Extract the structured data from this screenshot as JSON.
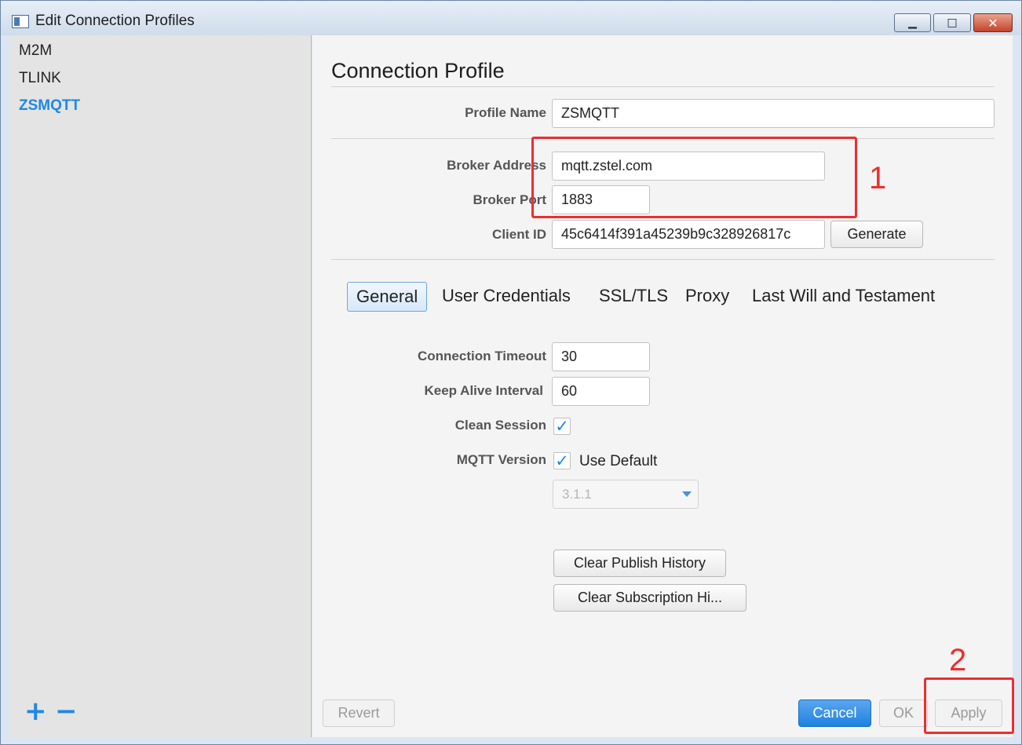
{
  "window": {
    "title": "Edit Connection Profiles"
  },
  "sidebar": {
    "profiles": [
      {
        "label": "M2M",
        "selected": false
      },
      {
        "label": "TLINK",
        "selected": false
      },
      {
        "label": "ZSMQTT",
        "selected": true
      }
    ],
    "add_label": "+",
    "remove_label": "−"
  },
  "profile": {
    "heading": "Connection Profile",
    "profile_name_label": "Profile Name",
    "profile_name": "ZSMQTT",
    "broker_address_label": "Broker Address",
    "broker_address": "mqtt.zstel.com",
    "broker_port_label": "Broker Port",
    "broker_port": "1883",
    "client_id_label": "Client ID",
    "client_id": "45c6414f391a45239b9c328926817c",
    "generate_label": "Generate"
  },
  "tabs": [
    {
      "label": "General",
      "active": true
    },
    {
      "label": "User Credentials",
      "active": false
    },
    {
      "label": "SSL/TLS",
      "active": false
    },
    {
      "label": "Proxy",
      "active": false
    },
    {
      "label": "Last Will and Testament",
      "active": false
    }
  ],
  "general": {
    "connection_timeout_label": "Connection Timeout",
    "connection_timeout": "30",
    "keep_alive_label": "Keep Alive Interval",
    "keep_alive": "60",
    "clean_session_label": "Clean Session",
    "clean_session_checked": true,
    "mqtt_version_label": "MQTT Version",
    "use_default_label": "Use Default",
    "use_default_checked": true,
    "mqtt_version_value": "3.1.1",
    "clear_publish_label": "Clear Publish History",
    "clear_subscription_label": "Clear Subscription Hi..."
  },
  "footer": {
    "revert_label": "Revert",
    "cancel_label": "Cancel",
    "ok_label": "OK",
    "apply_label": "Apply"
  },
  "annotations": {
    "box1_label": "1",
    "box2_label": "2",
    "color": "#ef2d2d"
  },
  "colors": {
    "accent": "#1e88e5",
    "cancel_button": "#1e82e0"
  }
}
